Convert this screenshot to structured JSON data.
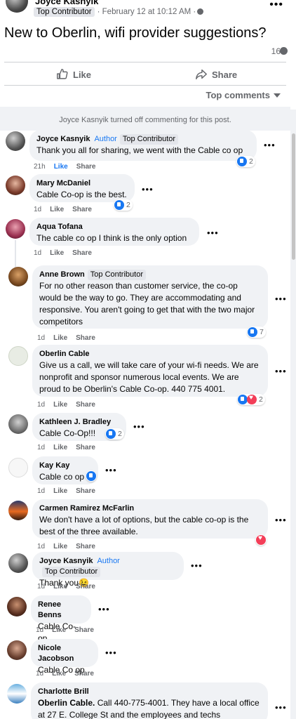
{
  "post": {
    "author": "Joyce Kasnyik",
    "badge": "Top Contributor",
    "meta": "· February 12 at 10:12 AM ·",
    "title": "New to Oberlin, wifi provider suggestions?",
    "comment_count": "16"
  },
  "actions": {
    "like": "Like",
    "share": "Share"
  },
  "sort": "Top comments",
  "notice": "Joyce Kasnyik turned off commenting for this post.",
  "labels": {
    "like": "Like",
    "share": "Share",
    "author": "Author",
    "top_contributor": "Top Contributor"
  },
  "comments": [
    {
      "name": "Joyce Kasnyik",
      "text": "Thank you all for sharing, we went with the Cable co op",
      "time": "21h",
      "react_count": "2"
    },
    {
      "name": "Mary McDaniel",
      "text": "Cable Co-op is the best.",
      "time": "1d",
      "react_count": "2"
    },
    {
      "name": "Aqua Tofana",
      "text": "The cable co op I think is the only option",
      "time": "1d"
    },
    {
      "name": "Anne Brown",
      "text": "For no other reason than customer service, the co-op would be the way to go. They are accommodating and responsive. You aren't going to get that with the two major competitors",
      "time": "1d",
      "react_count": "7"
    },
    {
      "name": "Oberlin Cable",
      "text": "Give us a call, we will take care of your wi-fi needs. We are nonprofit and sponsor numerous local events. We are proud to be Oberlin's Cable Co-op. 440 775 4001.",
      "time": "1d",
      "react_count": "2"
    },
    {
      "name": "Kathleen J. Bradley",
      "text": "Cable Co-Op!!!",
      "time": "1d",
      "react_count": "2"
    },
    {
      "name": "Kay Kay",
      "text": "Cable co op",
      "time": "1d"
    },
    {
      "name": "Carmen Ramirez McFarlin",
      "text": "We don't have a lot of options, but the cable co-op is the best of the three available.",
      "time": "1d"
    },
    {
      "name": "Joyce Kasnyik",
      "text": "Thank you",
      "emoji": "😉",
      "time": "1d"
    },
    {
      "name": "Renee Benns",
      "text": "Cable Co-op",
      "time": "1d"
    },
    {
      "name": "Nicole Jacobson",
      "text": "Cable Co op",
      "time": "1d"
    },
    {
      "name": "Charlotte Brill",
      "text_bold": "Oberlin Cable.",
      "text": " Call 440-775-4001. They have a local office at 27 E. College St and the employees and techs"
    }
  ]
}
